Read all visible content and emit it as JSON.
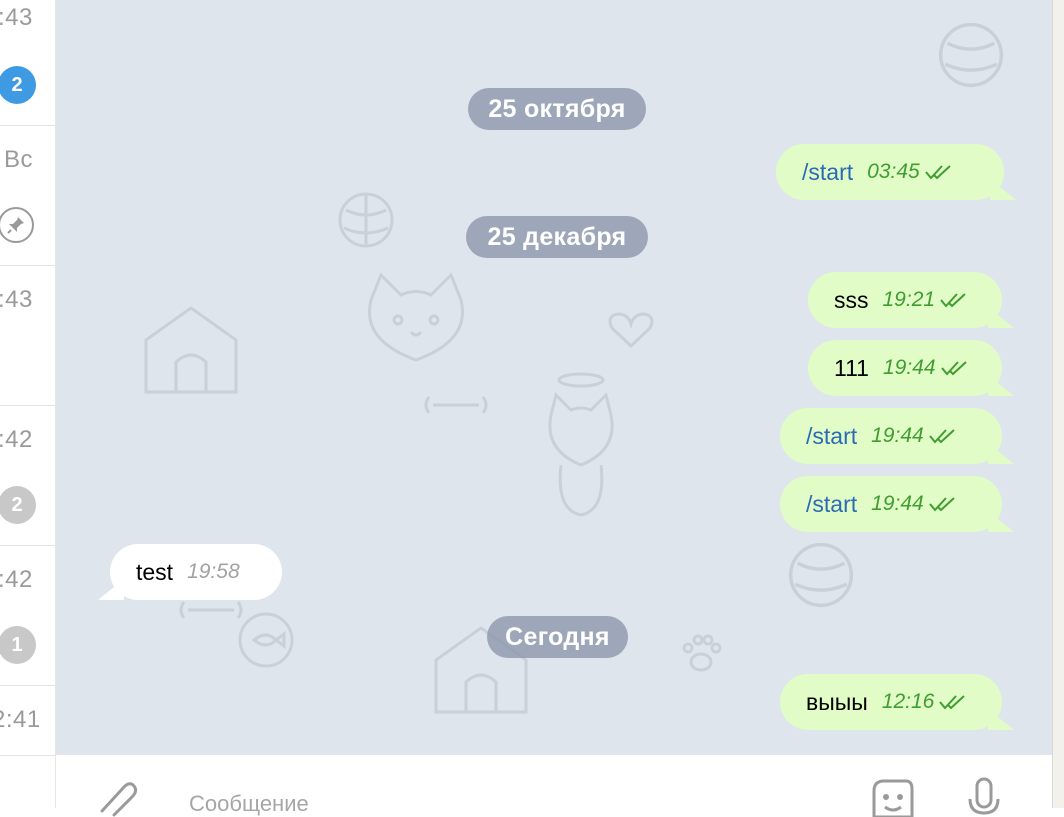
{
  "sidebar": {
    "items": [
      {
        "time": ":43",
        "badge": "2",
        "badge_style": "blue"
      },
      {
        "time": "Вс",
        "badge": "",
        "badge_style": "pin"
      },
      {
        "time": ":43",
        "badge": "",
        "badge_style": ""
      },
      {
        "time": ":42",
        "badge": "2",
        "badge_style": "grey"
      },
      {
        "time": ":42",
        "badge": "1",
        "badge_style": "grey"
      },
      {
        "time": "2:41",
        "badge": "",
        "badge_style": ""
      }
    ]
  },
  "chat": {
    "date_separators": [
      "25 октября",
      "25 декабря",
      "Сегодня"
    ],
    "messages": [
      {
        "direction": "out",
        "text": "/start",
        "time": "03:45",
        "is_command": true,
        "status": "read"
      },
      {
        "direction": "out",
        "text": "sss",
        "time": "19:21",
        "is_command": false,
        "status": "read"
      },
      {
        "direction": "out",
        "text": "111",
        "time": "19:44",
        "is_command": false,
        "status": "read"
      },
      {
        "direction": "out",
        "text": "/start",
        "time": "19:44",
        "is_command": true,
        "status": "read"
      },
      {
        "direction": "out",
        "text": "/start",
        "time": "19:44",
        "is_command": true,
        "status": "read"
      },
      {
        "direction": "in",
        "text": "test",
        "time": "19:58",
        "is_command": false,
        "status": ""
      },
      {
        "direction": "out",
        "text": "выыы",
        "time": "12:16",
        "is_command": false,
        "status": "read"
      }
    ]
  },
  "input": {
    "placeholder": "Сообщение",
    "icons": [
      "attach-icon",
      "sticker-icon",
      "microphone-icon"
    ]
  },
  "colors": {
    "outgoing_bubble": "#e2fcc8",
    "incoming_bubble": "#ffffff",
    "chat_background": "#dfe5ec",
    "command_link": "#2a6bb5",
    "outgoing_time": "#3f9e2f",
    "unread_badge": "#3e9ae3"
  }
}
